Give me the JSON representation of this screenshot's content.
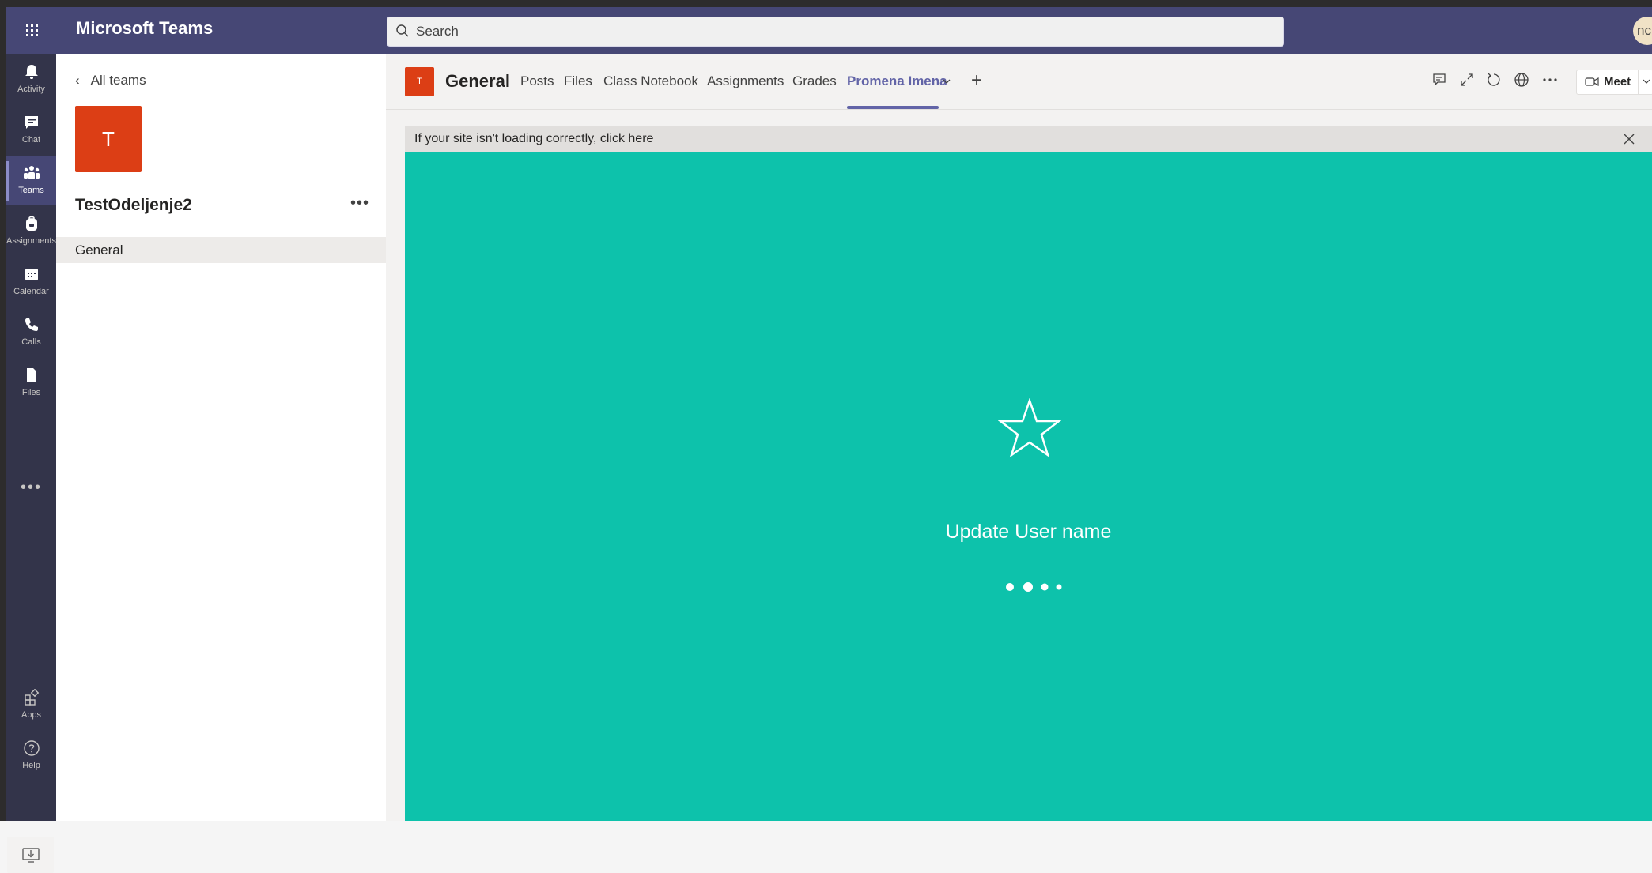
{
  "app": {
    "title": "Microsoft Teams",
    "accent": "#464775",
    "brand_purple": "#6264a7"
  },
  "search": {
    "placeholder": "Search"
  },
  "user": {
    "initials": "nc"
  },
  "rail": {
    "items": [
      {
        "label": "Activity",
        "icon": "bell-icon"
      },
      {
        "label": "Chat",
        "icon": "chat-icon"
      },
      {
        "label": "Teams",
        "icon": "teams-icon",
        "active": true
      },
      {
        "label": "Assignments",
        "icon": "backpack-icon"
      },
      {
        "label": "Calendar",
        "icon": "calendar-icon"
      },
      {
        "label": "Calls",
        "icon": "phone-icon"
      },
      {
        "label": "Files",
        "icon": "file-icon"
      }
    ],
    "more": "•••",
    "bottom": [
      {
        "label": "Apps",
        "icon": "apps-icon"
      },
      {
        "label": "Help",
        "icon": "help-icon"
      }
    ]
  },
  "team": {
    "back_label": "All teams",
    "tile_letter": "T",
    "name": "TestOdeljenje2",
    "more": "•••",
    "channels": [
      {
        "label": "General",
        "selected": true
      }
    ],
    "color": "#dc3e15"
  },
  "channel": {
    "tile_letter": "T",
    "title": "General",
    "tabs": [
      {
        "label": "Posts"
      },
      {
        "label": "Files"
      },
      {
        "label": "Class Notebook"
      },
      {
        "label": "Assignments"
      },
      {
        "label": "Grades"
      },
      {
        "label": "Promena Imena",
        "active": true
      }
    ],
    "add_tab": "+",
    "meet_label": "Meet"
  },
  "banner": {
    "text": "If your site isn't loading correctly, click here"
  },
  "content": {
    "title": "Update User name",
    "background": "#0dc2ab",
    "icon": "star-icon"
  }
}
